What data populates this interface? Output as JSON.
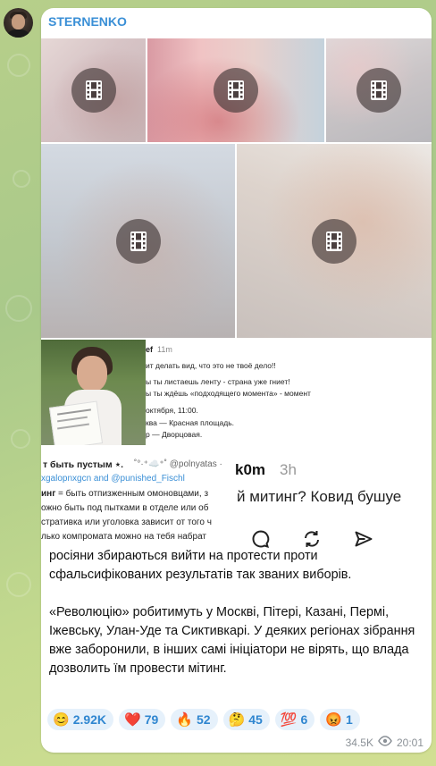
{
  "post": {
    "channel_name": "STERNENKO",
    "views": "34.5K",
    "time": "20:01",
    "paragraph_1": "росіяни збираються вийти на протести проти сфальсифікованих результатів так званих виборів.",
    "paragraph_2": "«Революцію» робитимуть у Москві, Пітері, Казані, Пермі, Іжевську, Улан-Уде та Сиктивкарі. У деяких регіонах зібрання вже заборонили, в інших самі ініціатори не вірять, що влада дозволить їм провести мітинг."
  },
  "media": {
    "video_icon": "film-icon",
    "collage": {
      "tweet_time": "11m",
      "tweet_name_fragment": "ef",
      "lines": [
        "ит делать вид, что это не твоё дело!!",
        "ы ты листаешь ленту - страна уже гниет!",
        "ы ты ждёшь «подходящего момента» - момент",
        "октября, 11:00.",
        "ква — Красная площадь.",
        "р — Дворцовая."
      ],
      "post2_title": "т быть пустым ⋆.",
      "post2_handle": "˚°·⁺☁️⁺˚ @polnyatas ·",
      "post2_links": "xgalopnxgcn and @punished_Fischl",
      "post2_bold": "инг",
      "post2_lines": [
        " = быть отпизженным омоновцами, з",
        "ожно быть под пытками в отделе или об",
        "стративка или уголовка зависит от того ч",
        "лько компромата можно на тебя набрат"
      ],
      "post3_user": "k0m",
      "post3_time": "3h",
      "post3_text": "й митинг? Ковид бушуе"
    }
  },
  "reactions": [
    {
      "emoji": "😊",
      "count": "2.92K"
    },
    {
      "emoji": "❤️",
      "count": "79"
    },
    {
      "emoji": "🔥",
      "count": "52"
    },
    {
      "emoji": "🤔",
      "count": "45"
    },
    {
      "emoji": "💯",
      "count": "6"
    },
    {
      "emoji": "😡",
      "count": "1"
    }
  ],
  "colors": {
    "accent": "#3a8fd6",
    "reaction_bg": "#e6f1fb",
    "meta_text": "#8b9197"
  }
}
